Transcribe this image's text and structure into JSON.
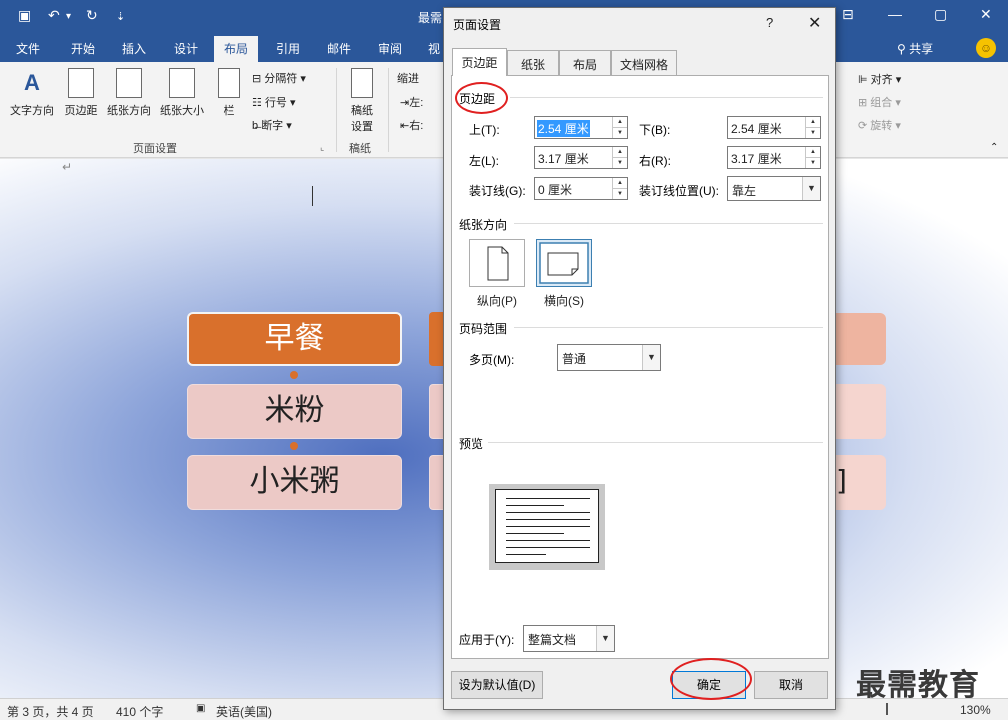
{
  "window": {
    "title": "最需",
    "controls": {
      "minimize": "—",
      "restore": "▢",
      "close": "✕",
      "box": "⊟"
    }
  },
  "qat": {
    "save": "▣",
    "undo": "↶",
    "undo_drop": "▾",
    "redo": "↻",
    "customize": "⇣"
  },
  "ribbon": {
    "tabs": [
      "文件",
      "开始",
      "插入",
      "设计",
      "布局",
      "引用",
      "邮件",
      "审阅",
      "视"
    ],
    "active_tab": "布局",
    "share": "共享",
    "page_setup_buttons": [
      "文字方向",
      "页边距",
      "纸张方向",
      "纸张大小",
      "栏"
    ],
    "small_items": {
      "breaks": "分隔符",
      "line_numbers": "行号",
      "hyphenation": "断字"
    },
    "manuscript_label": "稿纸\n设置",
    "manuscript_line1": "稿纸",
    "manuscript_line2": "设置",
    "indent_label": "缩进",
    "indent_left": "左:",
    "indent_right": "右:",
    "group_page_setup": "页面设置",
    "group_manuscript": "稿纸",
    "align": "对齐",
    "group": "组合",
    "rotate": "旋转"
  },
  "document": {
    "boxes": [
      "早餐",
      "米粉",
      "小米粥"
    ],
    "partial_char": "]",
    "return_mark": "↵"
  },
  "statusbar": {
    "page": "第 3 页，共 4 页",
    "words": "410 个字",
    "language": "英语(美国)",
    "zoom": "130%"
  },
  "watermark": "最需教育",
  "dialog": {
    "title": "页面设置",
    "help": "?",
    "close": "✕",
    "tabs": [
      "页边距",
      "纸张",
      "布局",
      "文档网格"
    ],
    "active_tab": "页边距",
    "margins_section": "页边距",
    "top_label": "上(T):",
    "top_value": "2.54 厘米",
    "bottom_label": "下(B):",
    "bottom_value": "2.54 厘米",
    "left_label": "左(L):",
    "left_value": "3.17 厘米",
    "right_label": "右(R):",
    "right_value": "3.17 厘米",
    "gutter_label": "装订线(G):",
    "gutter_value": "0 厘米",
    "gutter_pos_label": "装订线位置(U):",
    "gutter_pos_value": "靠左",
    "orientation_section": "纸张方向",
    "portrait": "纵向(P)",
    "landscape": "横向(S)",
    "orientation_selected": "横向(S)",
    "pages_section": "页码范围",
    "multi_pages_label": "多页(M):",
    "multi_pages_value": "普通",
    "preview_section": "预览",
    "apply_label": "应用于(Y):",
    "apply_value": "整篇文档",
    "set_default": "设为默认值(D)",
    "ok": "确定",
    "cancel": "取消"
  },
  "colors": {
    "brand": "#2b579a",
    "accent_orange": "#d9702c",
    "annotation_red": "#e02020",
    "selection": "#3399ff"
  }
}
